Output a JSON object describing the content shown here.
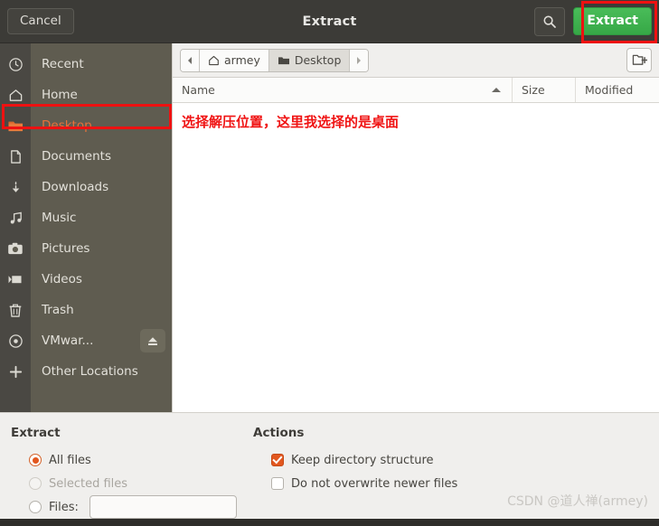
{
  "header": {
    "cancel_label": "Cancel",
    "title": "Extract",
    "search_icon": "search-icon",
    "extract_label": "Extract",
    "extract_button_color": "#3eb14f",
    "annotation_color": "#ee1111"
  },
  "sidebar": {
    "items": [
      {
        "label": "Recent",
        "icon": "clock-icon",
        "active": false
      },
      {
        "label": "Home",
        "icon": "home-icon",
        "active": false
      },
      {
        "label": "Desktop",
        "icon": "folder-icon",
        "active": true
      },
      {
        "label": "Documents",
        "icon": "document-icon",
        "active": false
      },
      {
        "label": "Downloads",
        "icon": "download-icon",
        "active": false
      },
      {
        "label": "Music",
        "icon": "music-note-icon",
        "active": false
      },
      {
        "label": "Pictures",
        "icon": "camera-icon",
        "active": false
      },
      {
        "label": "Videos",
        "icon": "video-icon",
        "active": false
      },
      {
        "label": "Trash",
        "icon": "trash-icon",
        "active": false
      },
      {
        "label": "VMwar...",
        "icon": "disc-icon",
        "active": false,
        "eject_icon": "eject-icon"
      },
      {
        "label": "Other Locations",
        "icon": "plus-icon",
        "active": false
      }
    ],
    "active_color": "#e8703a"
  },
  "pathbar": {
    "back_icon": "chevron-left-icon",
    "forward_icon": "chevron-right-icon",
    "crumbs": [
      {
        "label": "armey",
        "icon": "home-icon",
        "active": false
      },
      {
        "label": "Desktop",
        "icon": "folder-icon",
        "active": true
      }
    ],
    "new_folder_icon": "new-folder-icon"
  },
  "columns": {
    "name": "Name",
    "size": "Size",
    "modified": "Modified",
    "sort_icon": "sort-ascending-icon"
  },
  "filelist": {
    "rows": [],
    "annotation": "选择解压位置，这里我选择的是桌面"
  },
  "options": {
    "extract_title": "Extract",
    "all_files_label": "All files",
    "selected_files_label": "Selected files",
    "files_label": "Files:",
    "files_value": "",
    "files_placeholder": "",
    "actions_title": "Actions",
    "keep_structure_label": "Keep directory structure",
    "no_overwrite_label": "Do not overwrite newer files"
  },
  "watermark": "CSDN @道人禅(armey)"
}
